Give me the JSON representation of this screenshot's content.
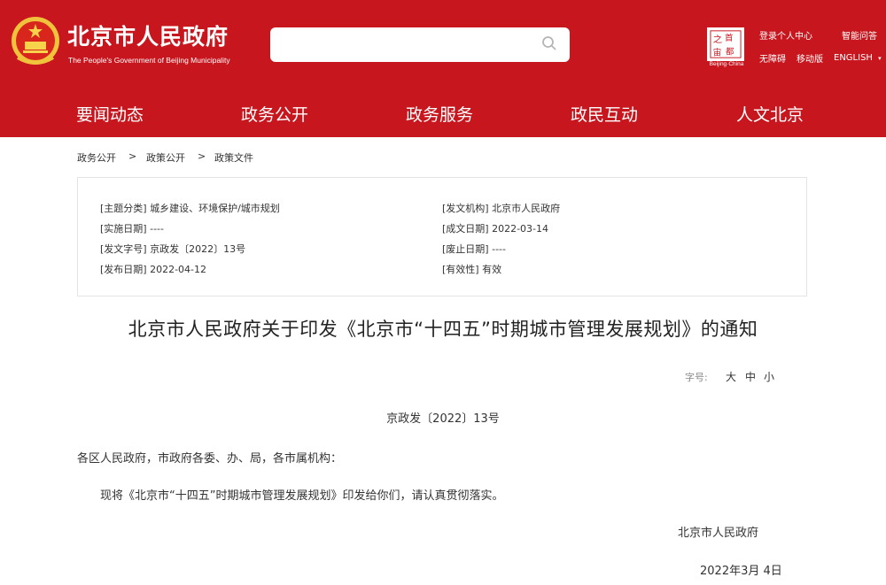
{
  "header": {
    "site_title": "北京市人民政府",
    "site_subtitle": "The People's Government of Beijing Municipality",
    "search_placeholder": "",
    "seal_caption": "Beijing·China",
    "links": {
      "login": "登录个人中心",
      "smart_qa": "智能问答",
      "accessibility": "无障碍",
      "mobile": "移动版",
      "language": "ENGLISH"
    },
    "brand_color": "#c8161e"
  },
  "nav": {
    "items": [
      "要闻动态",
      "政务公开",
      "政务服务",
      "政民互动",
      "人文北京"
    ]
  },
  "breadcrumb": {
    "items": [
      "政务公开",
      "政策公开",
      "政策文件"
    ],
    "separator": ">"
  },
  "meta": {
    "topic_key": "[主题分类]",
    "topic_val": "城乡建设、环境保护/城市规划",
    "issuer_key": "[发文机构]",
    "issuer_val": "北京市人民政府",
    "effective_key": "[实施日期]",
    "effective_val": "----",
    "written_key": "[成文日期]",
    "written_val": "2022-03-14",
    "docno_key": "[发文字号]",
    "docno_val": "京政发〔2022〕13号",
    "repeal_key": "[废止日期]",
    "repeal_val": "----",
    "published_key": "[发布日期]",
    "published_val": "2022-04-12",
    "validity_key": "[有效性]",
    "validity_val": "有效"
  },
  "article": {
    "title": "北京市人民政府关于印发《北京市“十四五”时期城市管理发展规划》的通知",
    "font_size_label": "字号:",
    "font_sizes": [
      "大",
      "中",
      "小"
    ],
    "doc_number": "京政发〔2022〕13号",
    "salutation": "各区人民政府，市政府各委、办、局，各市属机构：",
    "body": "现将《北京市“十四五”时期城市管理发展规划》印发给你们，请认真贯彻落实。",
    "signature": "北京市人民政府",
    "date": "2022年3月 4日"
  }
}
